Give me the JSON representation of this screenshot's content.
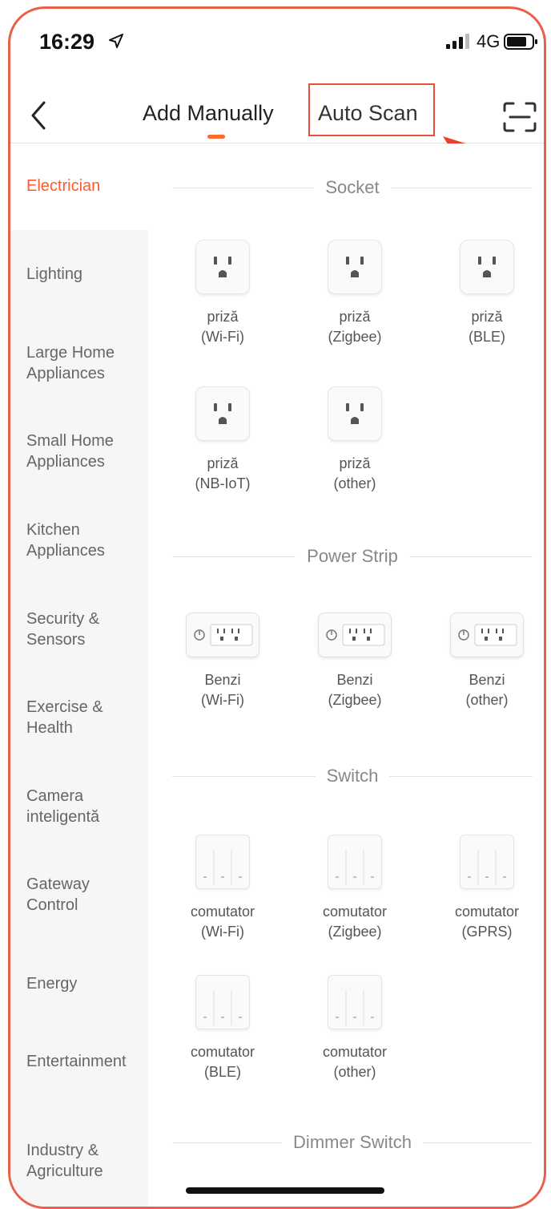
{
  "status_bar": {
    "time": "16:29",
    "network": "4G"
  },
  "header": {
    "tab_manual": "Add Manually",
    "tab_scan": "Auto Scan"
  },
  "colors": {
    "accent": "#ff5a2a",
    "annotation": "#e8503a"
  },
  "sidebar": {
    "items": [
      {
        "label": "Electrician",
        "active": true
      },
      {
        "label": "Lighting"
      },
      {
        "label": "Large Home Appliances"
      },
      {
        "label": "Small Home Appliances"
      },
      {
        "label": "Kitchen Appliances"
      },
      {
        "label": "Security & Sensors"
      },
      {
        "label": "Exercise & Health"
      },
      {
        "label": "Camera inteligentă"
      },
      {
        "label": "Gateway Control"
      },
      {
        "label": "Energy"
      },
      {
        "label": "Entertainment"
      },
      {
        "label": "Industry & Agriculture"
      }
    ]
  },
  "sections": [
    {
      "title": "Socket",
      "icon": "socket-icon",
      "devices": [
        {
          "name": "priză",
          "variant": "(Wi-Fi)"
        },
        {
          "name": "priză",
          "variant": "(Zigbee)"
        },
        {
          "name": "priză",
          "variant": "(BLE)"
        },
        {
          "name": "priză",
          "variant": "(NB-IoT)"
        },
        {
          "name": "priză",
          "variant": "(other)"
        }
      ]
    },
    {
      "title": "Power Strip",
      "icon": "power-strip-icon",
      "devices": [
        {
          "name": "Benzi",
          "variant": "(Wi-Fi)"
        },
        {
          "name": "Benzi",
          "variant": "(Zigbee)"
        },
        {
          "name": "Benzi",
          "variant": "(other)"
        }
      ]
    },
    {
      "title": "Switch",
      "icon": "switch-icon",
      "devices": [
        {
          "name": "comutator",
          "variant": "(Wi-Fi)"
        },
        {
          "name": "comutator",
          "variant": "(Zigbee)"
        },
        {
          "name": "comutator",
          "variant": "(GPRS)"
        },
        {
          "name": "comutator",
          "variant": "(BLE)"
        },
        {
          "name": "comutator",
          "variant": "(other)"
        }
      ]
    },
    {
      "title": "Dimmer Switch",
      "icon": "dimmer-switch-icon",
      "devices": []
    }
  ]
}
